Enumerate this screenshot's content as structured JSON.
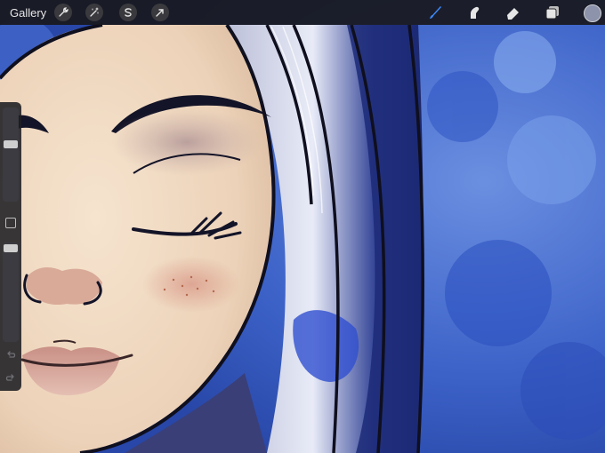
{
  "toolbar": {
    "gallery_label": "Gallery",
    "left_tools": [
      {
        "name": "actions",
        "icon": "wrench-icon"
      },
      {
        "name": "adjustments",
        "icon": "magic-wand-icon"
      },
      {
        "name": "selection",
        "icon": "selection-s-icon"
      },
      {
        "name": "transform",
        "icon": "arrow-cursor-icon"
      }
    ],
    "right_tools": [
      {
        "name": "brush",
        "icon": "brush-icon",
        "active": true
      },
      {
        "name": "smudge",
        "icon": "smudge-finger-icon"
      },
      {
        "name": "eraser",
        "icon": "eraser-icon"
      },
      {
        "name": "layers",
        "icon": "layers-icon"
      }
    ],
    "active_color": "#8c93aa",
    "accent": "#3d8bff"
  },
  "sidebar": {
    "brush_size_level": 0.62,
    "opacity_level": 0.98,
    "icons": [
      "modify-square-icon",
      "undo-arrow-icon",
      "redo-arrow-icon"
    ]
  },
  "canvas": {
    "description_colors": {
      "background_blue": "#3b5fc4",
      "skin": "#f2dcc4",
      "hair": "#1c1f3a",
      "lips": "#d8a89c"
    }
  }
}
